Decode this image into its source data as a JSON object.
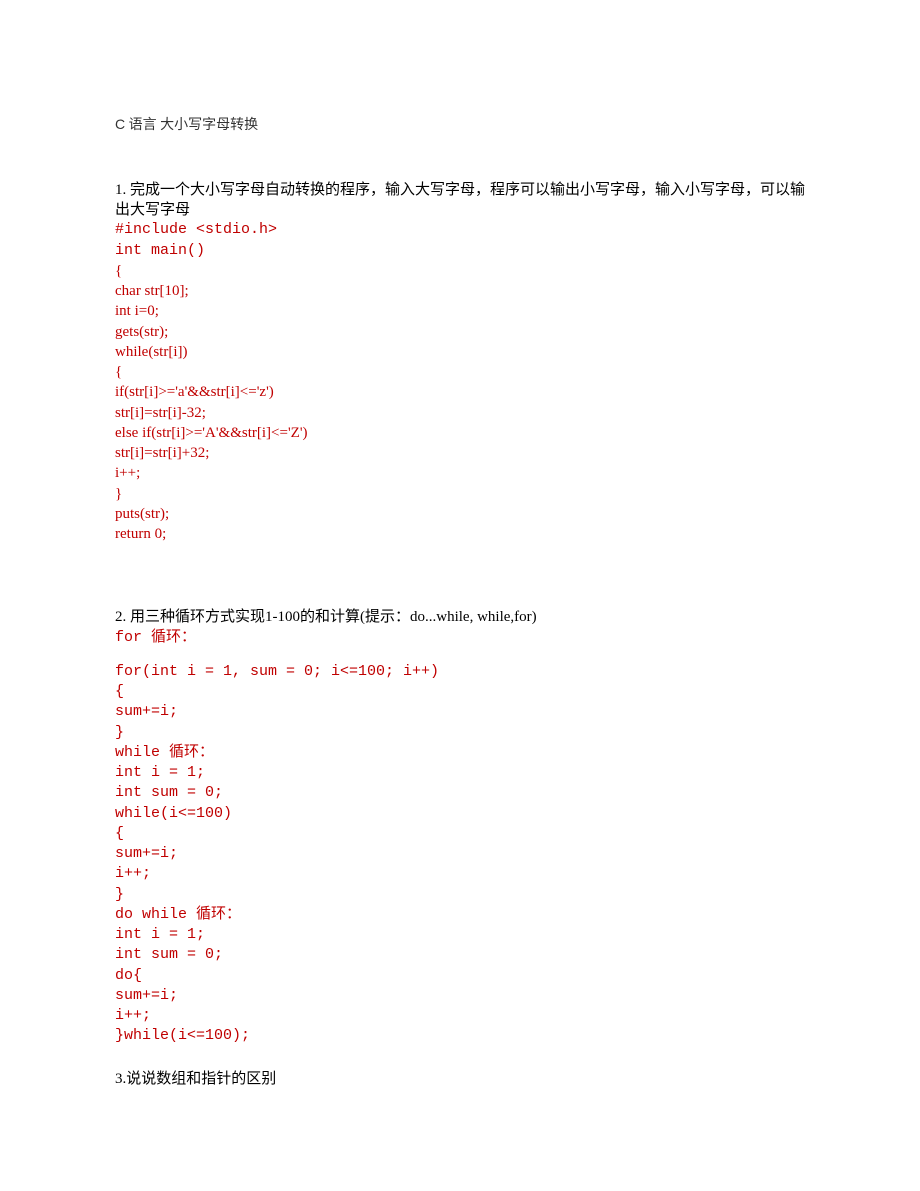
{
  "title": {
    "prefix": "C",
    "rest": " 语言 大小写字母转换"
  },
  "q1": {
    "prompt": "1. 完成一个大小写字母自动转换的程序，输入大写字母，程序可以输出小写字母，输入小写字母，可以输出大写字母",
    "code": [
      "#include <stdio.h>",
      "int main()",
      "{",
      "char str[10];",
      "int i=0;",
      "gets(str);",
      "while(str[i])",
      "{",
      "if(str[i]>='a'&&str[i]<='z')",
      "str[i]=str[i]-32;",
      "else if(str[i]>='A'&&str[i]<='Z')",
      "str[i]=str[i]+32;",
      "i++;",
      "}",
      "puts(str);",
      "return 0;"
    ]
  },
  "q2": {
    "prompt": "2. 用三种循环方式实现1-100的和计算(提示：do...while, while,for)",
    "forLabel": "for 循环：",
    "forCode": [
      "for(int i = 1, sum = 0; i<=100; i++)",
      "{",
      "sum+=i;",
      "}"
    ],
    "whileLabel": "while 循环：",
    "whileCode": [
      "int i = 1;",
      "int sum = 0;",
      "while(i<=100)",
      "{",
      "sum+=i;",
      "i++;",
      "}"
    ],
    "doLabel": "do while 循环：",
    "doCode": [
      "int i = 1;",
      "int sum = 0;",
      "do{",
      "sum+=i;",
      "i++;",
      "}while(i<=100);"
    ]
  },
  "q3": {
    "prompt": "3.说说数组和指针的区别"
  }
}
